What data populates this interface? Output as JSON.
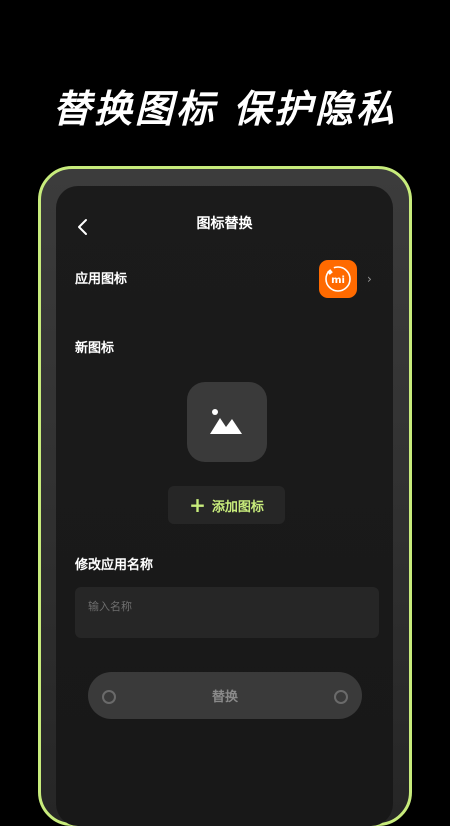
{
  "promo": {
    "headline": "替换图标 保护隐私"
  },
  "header": {
    "title": "图标替换",
    "back_icon": "chevron-left-icon"
  },
  "app_icon_row": {
    "label": "应用图标",
    "icon": "mi-app-icon",
    "icon_color": "#ff6a00",
    "icon_text": "mi"
  },
  "new_icon": {
    "label": "新图标",
    "placeholder_icon": "image-icon",
    "add_button_label": "添加图标"
  },
  "rename": {
    "label": "修改应用名称",
    "placeholder": "输入名称",
    "value": ""
  },
  "submit": {
    "label": "替换"
  },
  "colors": {
    "accent": "#c8ec7c",
    "background": "#000000",
    "panel": "#262626"
  }
}
